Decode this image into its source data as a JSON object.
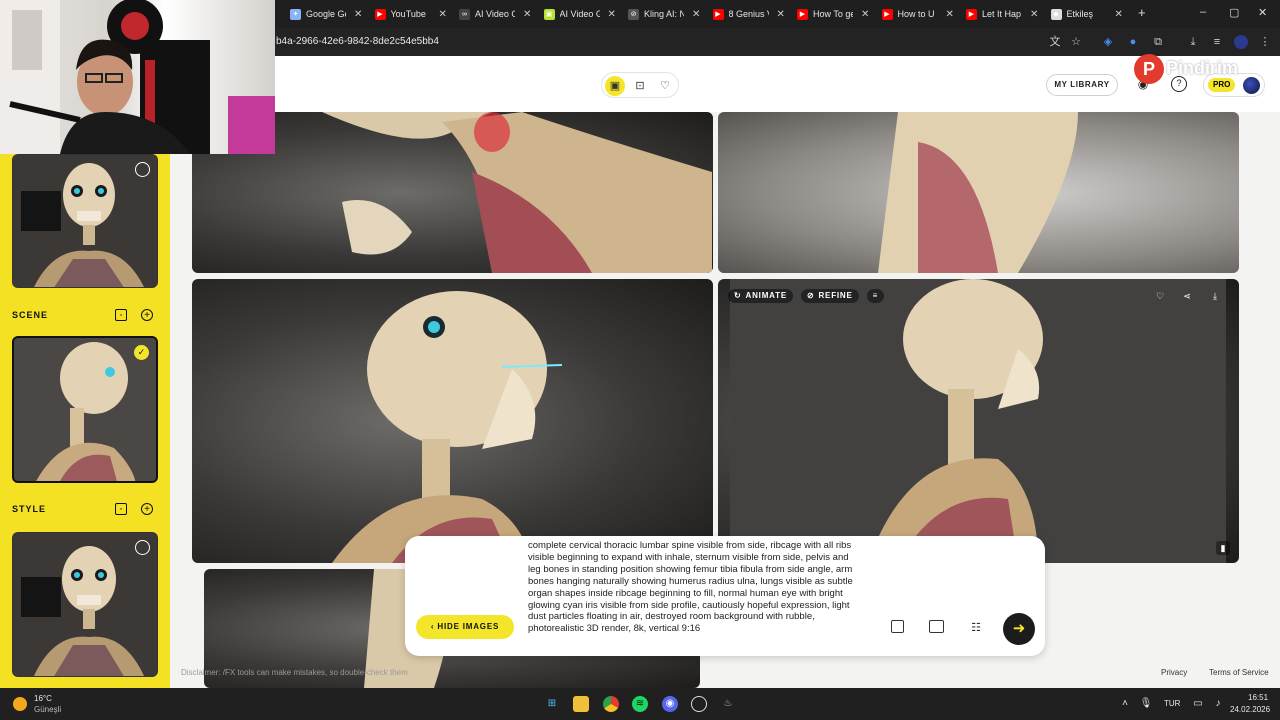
{
  "browser": {
    "tabs": [
      {
        "title": "Google Ge",
        "color": "#8ab4f8",
        "glyph": "✦"
      },
      {
        "title": "YouTube",
        "color": "#ff0000",
        "glyph": "▶"
      },
      {
        "title": "AI Video G",
        "color": "#444444",
        "glyph": "∞"
      },
      {
        "title": "AI Video G",
        "color": "#b7e22f",
        "glyph": "▣"
      },
      {
        "title": "Kling AI: N",
        "color": "#555555",
        "glyph": "⊘"
      },
      {
        "title": "8 Genius V",
        "color": "#ff0000",
        "glyph": "▶"
      },
      {
        "title": "How To ge",
        "color": "#ff0000",
        "glyph": "▶"
      },
      {
        "title": "How to U",
        "color": "#ff0000",
        "glyph": "▶"
      },
      {
        "title": "Let It Hap",
        "color": "#ff0000",
        "glyph": "▶"
      },
      {
        "title": "Etkileş",
        "color": "#dddddd",
        "glyph": "◆"
      }
    ],
    "new_tab": "+",
    "url": "b4a-2966-42e6-9842-8de2c54e5bb4"
  },
  "header": {
    "my_library": "MY LIBRARY",
    "pro_badge": "PRO",
    "watermark_letter": "P",
    "watermark_text": "Pindirim"
  },
  "sidebar": {
    "scene_label": "SCENE",
    "style_label": "STYLE"
  },
  "gallery": {
    "animate_label": "ANIMATE",
    "refine_label": "REFINE"
  },
  "prompt": {
    "text": "complete cervical thoracic lumbar spine visible from side, ribcage with all ribs visible beginning to expand with inhale, sternum visible from side, pelvis and leg bones in standing position showing femur tibia fibula from side angle, arm bones hanging naturally showing humerus radius ulna, lungs visible as subtle organ shapes inside ribcage beginning to fill, normal human eye with bright glowing cyan iris visible from side profile, cautiously hopeful expression, light dust particles floating in air, destroyed room background with rubble, photorealistic 3D render, 8k, vertical 9:16",
    "hide_images": "HIDE IMAGES"
  },
  "footer": {
    "disclaimer": "Disclaimer: /FX tools can make mistakes, so double-check them",
    "privacy": "Privacy",
    "terms": "Terms of Service"
  },
  "taskbar": {
    "temp": "16°C",
    "weather": "Güneşli",
    "lang": "TUR",
    "time": "16:51",
    "date": "24.02.2026"
  }
}
